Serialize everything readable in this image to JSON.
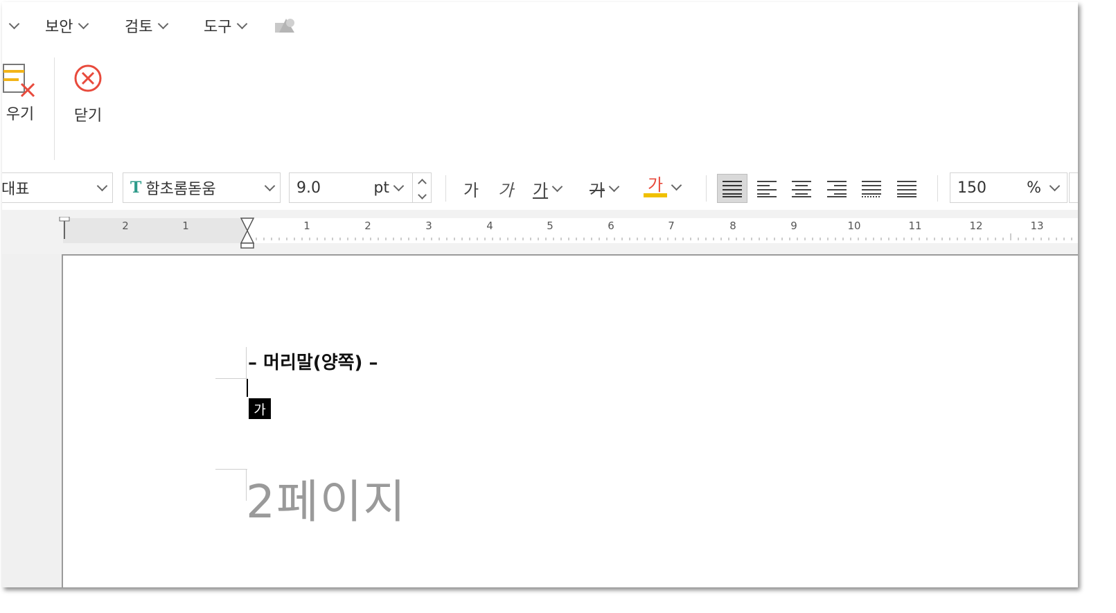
{
  "menu": {
    "items": [
      {
        "label": "보안"
      },
      {
        "label": "검토"
      },
      {
        "label": "도구"
      }
    ]
  },
  "ribbon": {
    "clear_label": "우기",
    "close_label": "닫기"
  },
  "toolbar": {
    "style_value": "대표",
    "font_value": "함초롬돋움",
    "size_value": "9.0",
    "size_unit": "pt",
    "bold_glyph": "가",
    "italic_glyph": "가",
    "underline_glyph": "가",
    "strike_glyph": "가",
    "color_glyph": "가",
    "line_spacing_value": "150",
    "line_spacing_unit": "%"
  },
  "ruler": {
    "labels": [
      "2",
      "1",
      "1",
      "2",
      "3",
      "4",
      "5",
      "6",
      "7",
      "8",
      "9",
      "10",
      "11",
      "12",
      "13"
    ]
  },
  "document": {
    "header_text": "– 머리말(양쪽) –",
    "ime_glyph": "가",
    "body_text": "2페이지"
  },
  "colors": {
    "close_icon": "#e84a3c",
    "highlight_bar": "#f0c000",
    "color_text": "#e84a3c",
    "font_icon": "#2e9b8a"
  }
}
